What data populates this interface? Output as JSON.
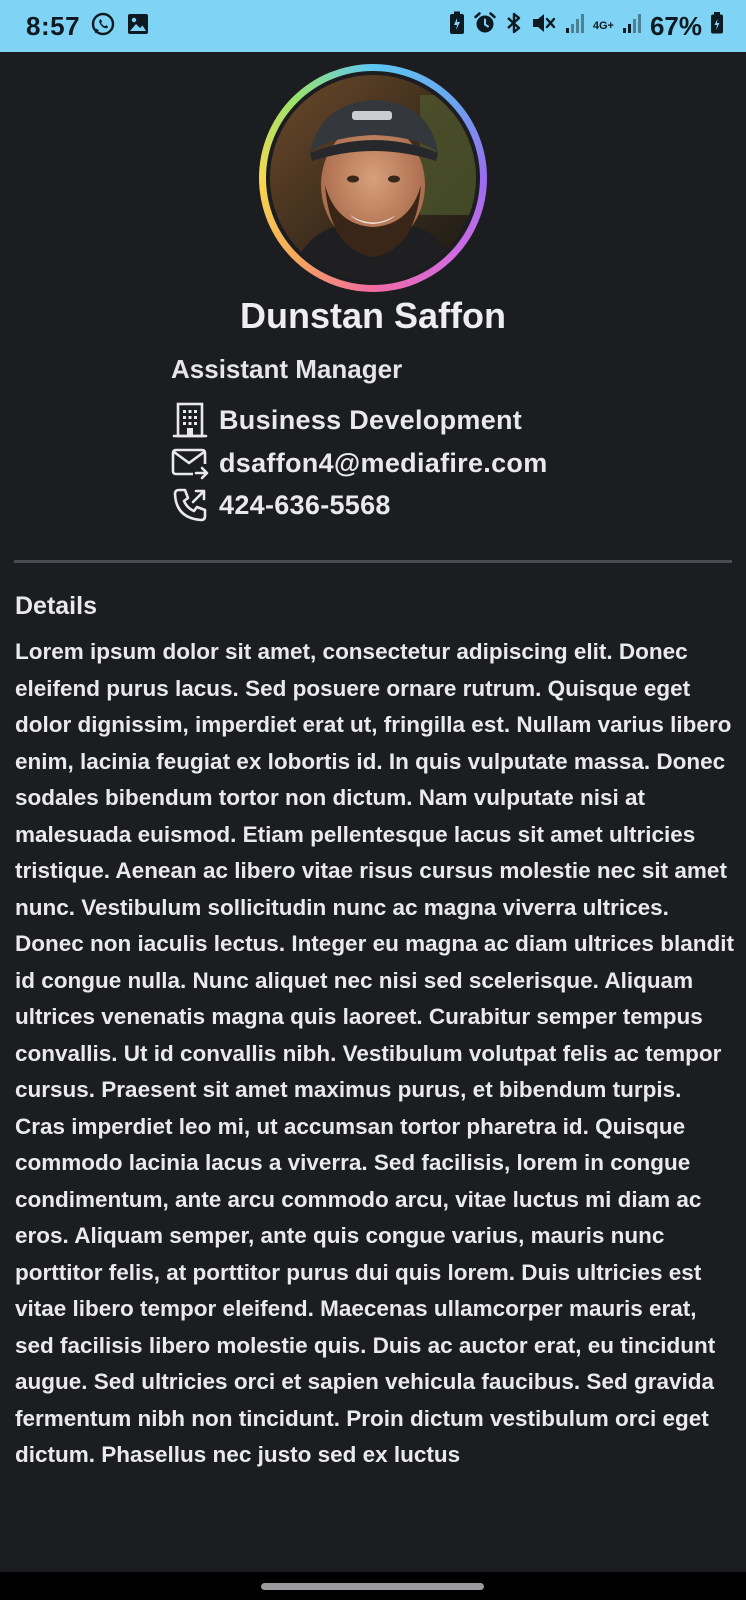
{
  "status_bar": {
    "time": "8:57",
    "network_label": "4G+",
    "battery": "67%"
  },
  "profile": {
    "name": "Dunstan Saffon",
    "title": "Assistant Manager",
    "department": "Business Development",
    "email": "dsaffon4@mediafire.com",
    "phone": "424-636-5568"
  },
  "details": {
    "heading": "Details",
    "body": "Lorem ipsum dolor sit amet, consectetur adipiscing elit. Donec eleifend purus lacus. Sed posuere ornare rutrum. Quisque eget dolor dignissim, imperdiet erat ut, fringilla est. Nullam varius libero enim, lacinia feugiat ex lobortis id. In quis vulputate massa. Donec sodales bibendum tortor non dictum. Nam vulputate nisi at malesuada euismod. Etiam pellentesque lacus sit amet ultricies tristique. Aenean ac libero vitae risus cursus molestie nec sit amet nunc. Vestibulum sollicitudin nunc ac magna viverra ultrices. Donec non iaculis lectus. Integer eu magna ac diam ultrices blandit id congue nulla. Nunc aliquet nec nisi sed scelerisque. Aliquam ultrices venenatis magna quis laoreet. Curabitur semper tempus convallis. Ut id convallis nibh. Vestibulum volutpat felis ac tempor cursus. Praesent sit amet maximus purus, et bibendum turpis. Cras imperdiet leo mi, ut accumsan tortor pharetra id. Quisque commodo lacinia lacus a viverra. Sed facilisis, lorem in congue condimentum, ante arcu commodo arcu, vitae luctus mi diam ac eros. Aliquam semper, ante quis congue varius, mauris nunc porttitor felis, at porttitor purus dui quis lorem. Duis ultricies est vitae libero tempor eleifend. Maecenas ullamcorper mauris erat, sed facilisis libero molestie quis. Duis ac auctor erat, eu tincidunt augue. Sed ultricies orci et sapien vehicula faucibus. Sed gravida fermentum nibh non tincidunt. Proin dictum vestibulum orci eget dictum. Phasellus nec justo sed ex luctus"
  },
  "icons": {
    "department": "building-icon",
    "email": "mail-forward-icon",
    "phone": "phone-outgoing-icon"
  },
  "colors": {
    "background": "#1b1d20",
    "status_bar": "#7fd3f5",
    "divider": "#4a4c51",
    "text": "#e9e9ea"
  }
}
